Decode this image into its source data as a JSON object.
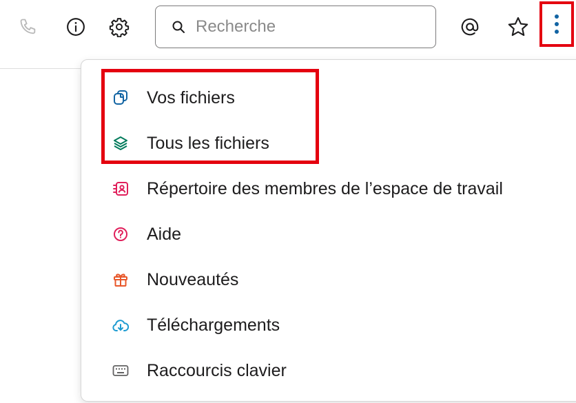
{
  "toolbar": {
    "icons": [
      "phone-icon",
      "info-icon",
      "gear-icon",
      "at-icon",
      "star-icon",
      "more-vertical-icon"
    ],
    "search": {
      "placeholder": "Recherche"
    }
  },
  "menu": {
    "items": [
      {
        "label": "Vos fichiers",
        "icon": "files-icon",
        "color": "#1264a3"
      },
      {
        "label": "Tous les fichiers",
        "icon": "layers-icon",
        "color": "#007a5a"
      },
      {
        "label": "Répertoire des membres de l’espace de travail",
        "icon": "member-directory-icon",
        "color": "#e01e5a"
      },
      {
        "label": "Aide",
        "icon": "help-icon",
        "color": "#e01e5a"
      },
      {
        "label": "Nouveautés",
        "icon": "gift-icon",
        "color": "#e8572a"
      },
      {
        "label": "Téléchargements",
        "icon": "download-cloud-icon",
        "color": "#1d9bd1"
      },
      {
        "label": "Raccourcis clavier",
        "icon": "keyboard-icon",
        "color": "#616061"
      }
    ]
  },
  "colors": {
    "highlight": "#e4000f",
    "accent_blue": "#1264a3"
  }
}
